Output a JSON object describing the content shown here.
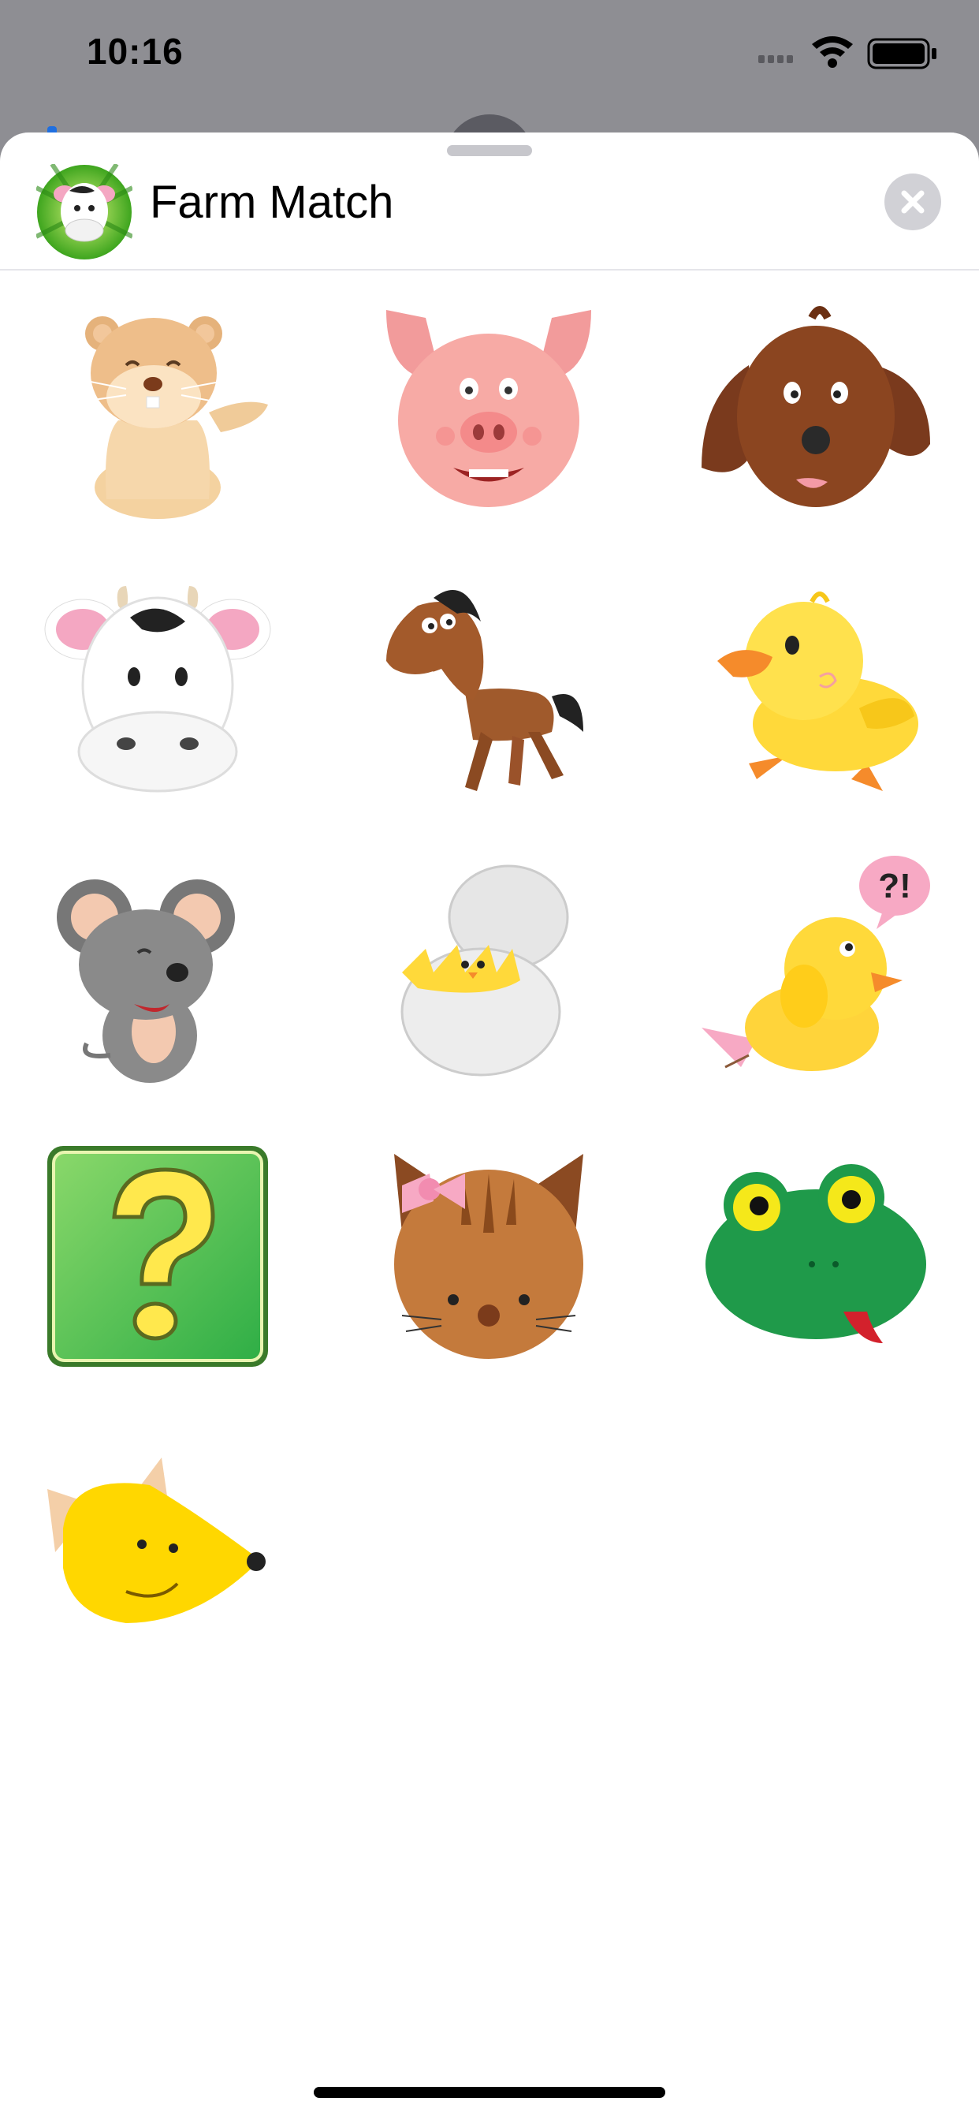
{
  "status_bar": {
    "time": "10:16",
    "icons": [
      "signal-icon",
      "wifi-icon",
      "battery-icon"
    ]
  },
  "header": {
    "app_name": "Farm Match",
    "app_icon": "cow-app-icon",
    "close_icon": "close-icon"
  },
  "stickers": [
    {
      "name": "hamster",
      "icon": "hamster-icon"
    },
    {
      "name": "pig",
      "icon": "pig-icon"
    },
    {
      "name": "dog",
      "icon": "dog-icon"
    },
    {
      "name": "cow",
      "icon": "cow-icon"
    },
    {
      "name": "horse",
      "icon": "horse-icon"
    },
    {
      "name": "duck",
      "icon": "duck-icon"
    },
    {
      "name": "mouse",
      "icon": "mouse-icon"
    },
    {
      "name": "hatching-chick",
      "icon": "hatching-chick-icon"
    },
    {
      "name": "confused-chick",
      "icon": "confused-chick-icon",
      "bubble_text": "?!"
    },
    {
      "name": "question-mark-card",
      "icon": "question-mark-icon"
    },
    {
      "name": "cat",
      "icon": "cat-icon"
    },
    {
      "name": "frog",
      "icon": "frog-icon"
    },
    {
      "name": "fox",
      "icon": "fox-icon"
    }
  ],
  "colors": {
    "sheet_background": "#ffffff",
    "dim_background": "#8e8e93",
    "close_button": "#d1d1d6"
  }
}
